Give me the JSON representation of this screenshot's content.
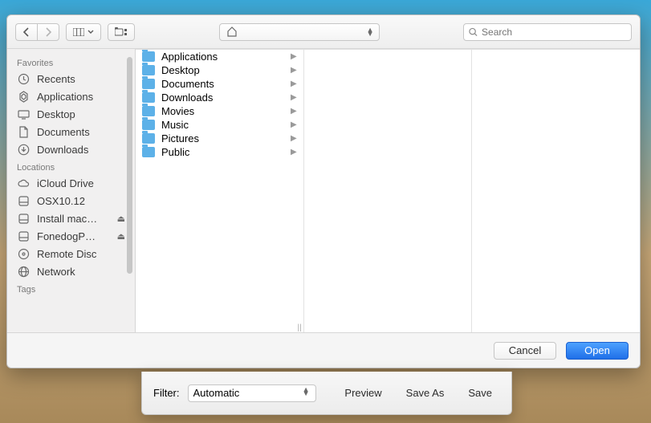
{
  "toolbar": {
    "back_label": "‹",
    "forward_label": "›",
    "view_label": "⊞",
    "newfolder_label": "⧉"
  },
  "path": {
    "current_name": ""
  },
  "search": {
    "placeholder": "Search"
  },
  "sidebar": {
    "sections": [
      {
        "title": "Favorites",
        "items": [
          {
            "icon": "recents",
            "label": "Recents"
          },
          {
            "icon": "applications",
            "label": "Applications"
          },
          {
            "icon": "desktop",
            "label": "Desktop"
          },
          {
            "icon": "documents",
            "label": "Documents"
          },
          {
            "icon": "downloads",
            "label": "Downloads"
          }
        ]
      },
      {
        "title": "Locations",
        "items": [
          {
            "icon": "cloud",
            "label": "iCloud Drive"
          },
          {
            "icon": "disk",
            "label": "OSX10.12"
          },
          {
            "icon": "disk",
            "label": "Install mac…",
            "eject": true
          },
          {
            "icon": "disk",
            "label": "FonedogP…",
            "eject": true
          },
          {
            "icon": "disc",
            "label": "Remote Disc"
          },
          {
            "icon": "network",
            "label": "Network"
          }
        ]
      },
      {
        "title": "Tags",
        "items": []
      }
    ]
  },
  "column1": [
    {
      "name": "Applications"
    },
    {
      "name": "Desktop"
    },
    {
      "name": "Documents"
    },
    {
      "name": "Downloads"
    },
    {
      "name": "Movies"
    },
    {
      "name": "Music"
    },
    {
      "name": "Pictures"
    },
    {
      "name": "Public"
    }
  ],
  "footer": {
    "cancel": "Cancel",
    "open": "Open"
  },
  "sheet": {
    "filter_label": "Filter:",
    "filter_value": "Automatic",
    "preview": "Preview",
    "saveas": "Save As",
    "save": "Save"
  }
}
